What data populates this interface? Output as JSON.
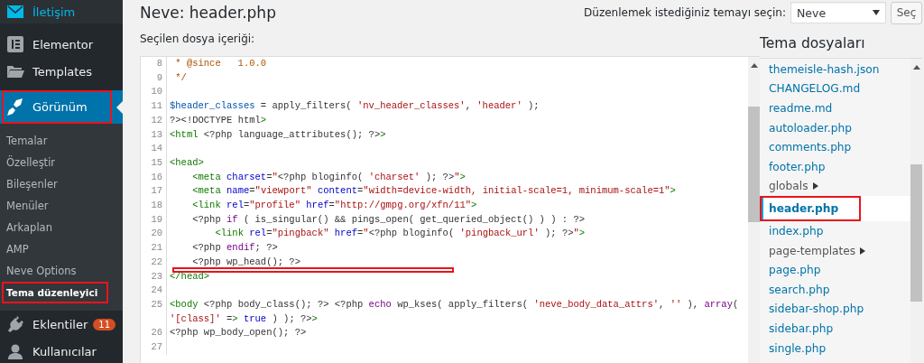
{
  "sidebar": {
    "items": [
      {
        "label": "İletişim",
        "hovered": true,
        "selected": false,
        "highlighted": false
      },
      {
        "label": "Elementor",
        "hovered": false,
        "selected": false,
        "highlighted": false
      },
      {
        "label": "Templates",
        "hovered": false,
        "selected": false,
        "highlighted": false
      },
      {
        "label": "Görünüm",
        "hovered": false,
        "selected": true,
        "highlighted": true,
        "children": [
          {
            "label": "Temalar",
            "selected": false,
            "highlighted": false
          },
          {
            "label": "Özelleştir",
            "selected": false,
            "highlighted": false
          },
          {
            "label": "Bileşenler",
            "selected": false,
            "highlighted": false
          },
          {
            "label": "Menüler",
            "selected": false,
            "highlighted": false
          },
          {
            "label": "Arkaplan",
            "selected": false,
            "highlighted": false
          },
          {
            "label": "AMP",
            "selected": false,
            "highlighted": false
          },
          {
            "label": "Neve Options",
            "selected": false,
            "highlighted": false
          },
          {
            "label": "Tema düzenleyici",
            "selected": true,
            "highlighted": true
          }
        ]
      },
      {
        "label": "Eklentiler",
        "badge": "11",
        "hovered": false,
        "selected": false,
        "highlighted": false
      },
      {
        "label": "Kullanıcılar",
        "hovered": false,
        "selected": false,
        "highlighted": false
      }
    ]
  },
  "page": {
    "title": "Neve: header.php",
    "theme_select": {
      "label": "Düzenlemek istediğiniz temayı seçin:",
      "value": "Neve",
      "button": "Seç"
    },
    "content_label": "Seçilen dosya içeriği:"
  },
  "editor": {
    "lines": [
      {
        "number": "8",
        "annotated": false,
        "rows": [
          " * @since   1.0.0"
        ]
      },
      {
        "number": "9",
        "annotated": false,
        "rows": [
          " */"
        ]
      },
      {
        "number": "10",
        "annotated": false
      },
      {
        "number": "11",
        "annotated": false,
        "rows": [
          "$header_classes = apply_filters( 'nv_header_classes', 'header' );"
        ]
      },
      {
        "number": "12",
        "annotated": false,
        "rows": [
          "?><!DOCTYPE html>"
        ]
      },
      {
        "number": "13",
        "annotated": false,
        "rows": [
          "<html <?php language_attributes(); ?>>"
        ]
      },
      {
        "number": "14",
        "annotated": false
      },
      {
        "number": "15",
        "annotated": false,
        "rows": [
          "<head>"
        ]
      },
      {
        "number": "16",
        "annotated": false,
        "rows": [
          "    <meta charset=\"<?php bloginfo( 'charset' ); ?>\">"
        ]
      },
      {
        "number": "17",
        "annotated": false,
        "rows": [
          "    <meta name=\"viewport\" content=\"width=device-width, initial-scale=1, minimum-scale=1\">"
        ]
      },
      {
        "number": "18",
        "annotated": false,
        "rows": [
          "    <link rel=\"profile\" href=\"http://gmpg.org/xfn/11\">"
        ]
      },
      {
        "number": "19",
        "annotated": false,
        "rows": [
          "    <?php if ( is_singular() && pings_open( get_queried_object() ) ) : ?>"
        ]
      },
      {
        "number": "20",
        "annotated": false,
        "rows": [
          "        <link rel=\"pingback\" href=\"<?php bloginfo( 'pingback_url' ); ?>\">"
        ]
      },
      {
        "number": "21",
        "annotated": false,
        "rows": [
          "    <?php endif; ?>"
        ]
      },
      {
        "number": "22",
        "annotated": true,
        "rows": [
          "    <?php wp_head(); ?>"
        ]
      },
      {
        "number": "23",
        "annotated": false,
        "rows": [
          "</head>"
        ]
      },
      {
        "number": "24",
        "annotated": false
      },
      {
        "number": "25",
        "annotated": false,
        "rows": [
          "<body <?php body_class(); ?> <?php echo wp_kses( apply_filters( 'neve_body_data_attrs', '' ), array(",
          "'[class]' => true ) ); ?>>"
        ]
      },
      {
        "number": "26",
        "annotated": false,
        "rows": [
          "<?php wp_body_open(); ?>"
        ]
      },
      {
        "number": "27",
        "annotated": false
      }
    ]
  },
  "files": {
    "title": "Tema dosyaları",
    "items": [
      {
        "name": "themeisle-hash.json",
        "kind": "file",
        "selected": false,
        "highlighted": false
      },
      {
        "name": "CHANGELOG.md",
        "kind": "file",
        "selected": false,
        "highlighted": false
      },
      {
        "name": "readme.md",
        "kind": "file",
        "selected": false,
        "highlighted": false
      },
      {
        "name": "autoloader.php",
        "kind": "file",
        "selected": false,
        "highlighted": false
      },
      {
        "name": "comments.php",
        "kind": "file",
        "selected": false,
        "highlighted": false
      },
      {
        "name": "footer.php",
        "kind": "file",
        "selected": false,
        "highlighted": false
      },
      {
        "name": "globals",
        "kind": "folder",
        "selected": false,
        "highlighted": false
      },
      {
        "name": "header.php",
        "kind": "file",
        "selected": true,
        "highlighted": true
      },
      {
        "name": "index.php",
        "kind": "file",
        "selected": false,
        "highlighted": false
      },
      {
        "name": "page-templates",
        "kind": "folder",
        "selected": false,
        "highlighted": false
      },
      {
        "name": "page.php",
        "kind": "file",
        "selected": false,
        "highlighted": false
      },
      {
        "name": "search.php",
        "kind": "file",
        "selected": false,
        "highlighted": false
      },
      {
        "name": "sidebar-shop.php",
        "kind": "file",
        "selected": false,
        "highlighted": false
      },
      {
        "name": "sidebar.php",
        "kind": "file",
        "selected": false,
        "highlighted": false
      },
      {
        "name": "single.php",
        "kind": "file",
        "selected": false,
        "highlighted": false
      }
    ]
  }
}
